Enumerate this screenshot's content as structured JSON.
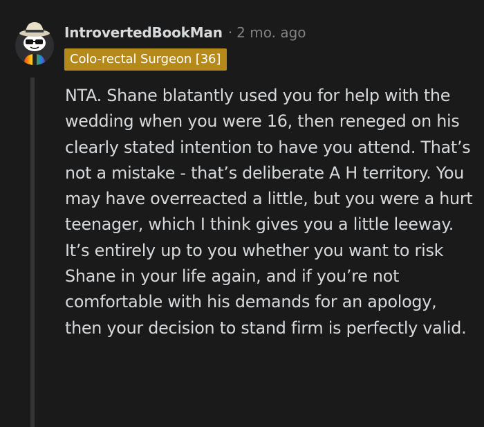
{
  "comment": {
    "author": "IntrovertedBookMan",
    "separator": "·",
    "timestamp": "2 mo. ago",
    "flair": "Colo-rectal Surgeon [36]",
    "flair_color": "#b58a1b",
    "avatar_icon": "snoo-avatar-sunglasses-hat-icon",
    "body": "NTA. Shane blatantly used you for help with the wedding when you were 16, then reneged on his clearly stated intention to have you attend. That’s not a mistake - that’s deliberate A H territory. You may have overreacted a little, but you were a hurt teenager, which I think gives you a little leeway. It’s entirely up to you whether you want to risk Shane in your life again, and if you’re not comfortable with his demands for an apology, then your decision to stand firm is perfectly valid."
  },
  "colors": {
    "background": "#1a1a1b",
    "text": "#d7dadc",
    "muted": "#818384",
    "thread_line": "#343536"
  }
}
